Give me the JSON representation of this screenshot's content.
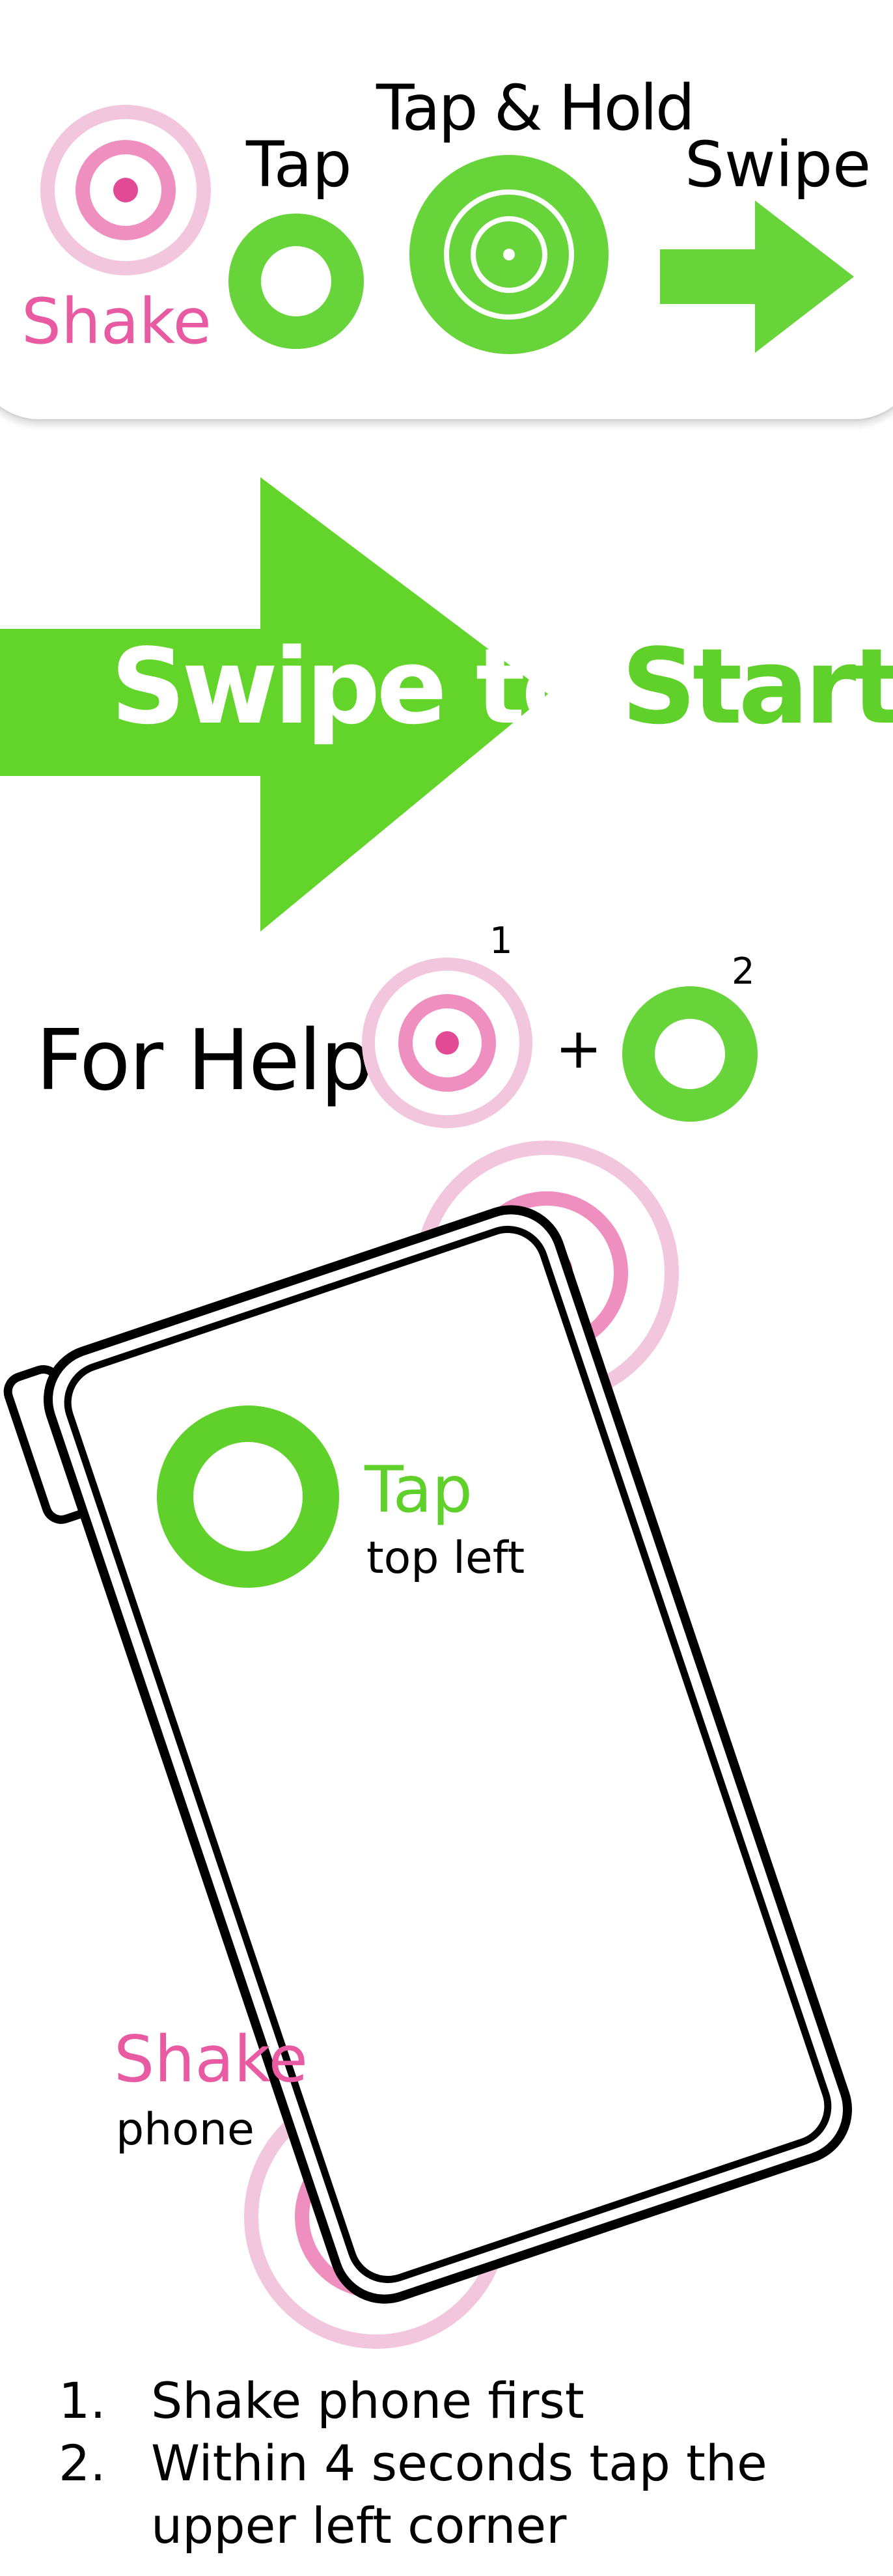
{
  "legend": {
    "shake": "Shake",
    "tap": "Tap",
    "tap_hold": "Tap & Hold",
    "swipe": "Swipe"
  },
  "start": {
    "swipe_to": "Swipe to ",
    "start": "Start"
  },
  "help": {
    "label": "For Help",
    "step1_marker": "1",
    "plus": "+",
    "step2_marker": "2"
  },
  "phone_diagram": {
    "tap_title": "Tap",
    "tap_subtitle": "top left",
    "shake_title": "Shake",
    "shake_subtitle": "phone"
  },
  "instructions": [
    {
      "number": "1.",
      "text": "Shake phone first"
    },
    {
      "number": "2.",
      "text": "Within 4 seconds tap the upper left corner"
    }
  ],
  "colors": {
    "green": "#5fd12a",
    "pink": "#e85aa2",
    "light_pink": "#f2c6dd",
    "black": "#000000"
  }
}
